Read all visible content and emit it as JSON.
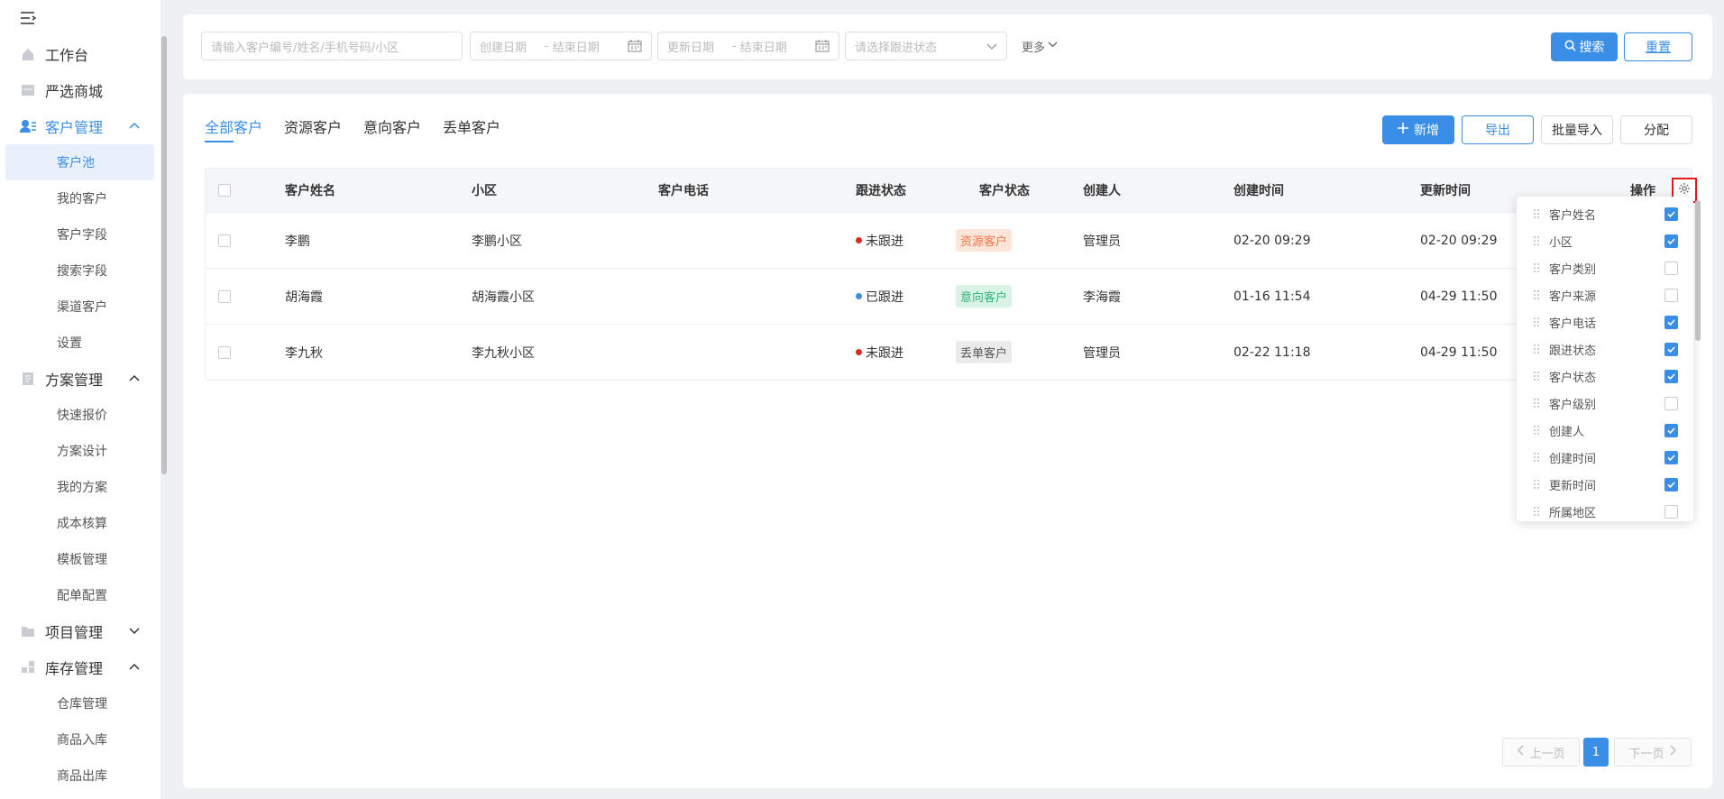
{
  "colors": {
    "accent": "#3a8ee6",
    "untracked_dot": "#e02a1a",
    "tracked_dot": "#3a8ee6"
  },
  "sidebar": {
    "toggle_icon": "menu-collapse-icon",
    "groups": [
      {
        "label": "工作台",
        "icon": "home-icon"
      },
      {
        "label": "严选商城",
        "icon": "shop-icon"
      },
      {
        "label": "客户管理",
        "icon": "customer-icon",
        "items": [
          "客户池",
          "我的客户",
          "客户字段",
          "搜索字段",
          "渠道客户",
          "设置"
        ]
      },
      {
        "label": "方案管理",
        "icon": "document-icon",
        "items": [
          "快速报价",
          "方案设计",
          "我的方案",
          "成本核算",
          "模板管理",
          "配单配置"
        ]
      },
      {
        "label": "项目管理",
        "icon": "folder-icon"
      },
      {
        "label": "库存管理",
        "icon": "inventory-icon",
        "items": [
          "仓库管理",
          "商品入库",
          "商品出库"
        ]
      }
    ]
  },
  "filters": {
    "keyword_placeholder": "请输入客户编号/姓名/手机号码/小区",
    "create_start_placeholder": "创建日期",
    "create_end_placeholder": "结束日期",
    "update_start_placeholder": "更新日期",
    "update_end_placeholder": "结束日期",
    "range_separator": "-",
    "status_placeholder": "请选择跟进状态",
    "more_label": "更多",
    "search_label": "搜索",
    "reset_label": "重置"
  },
  "tabs": [
    "全部客户",
    "资源客户",
    "意向客户",
    "丢单客户"
  ],
  "toolbar": {
    "add_label": "新增",
    "export_label": "导出",
    "import_label": "批量导入",
    "assign_label": "分配"
  },
  "table": {
    "columns": [
      "客户姓名",
      "小区",
      "客户电话",
      "跟进状态",
      "客户状态",
      "创建人",
      "创建时间",
      "更新时间",
      "操作"
    ],
    "rows": [
      {
        "name": "李鹏",
        "community": "李鹏小区",
        "phone": "",
        "follow": "未跟进",
        "status": "资源客户",
        "creator": "管理员",
        "created": "02-20 09:29",
        "updated": "02-20 09:29"
      },
      {
        "name": "胡海霞",
        "community": "胡海霞小区",
        "phone": "",
        "follow": "已跟进",
        "status": "意向客户",
        "creator": "李海霞",
        "created": "01-16 11:54",
        "updated": "04-29 11:50"
      },
      {
        "name": "李九秋",
        "community": "李九秋小区",
        "phone": "",
        "follow": "未跟进",
        "status": "丢单客户",
        "creator": "管理员",
        "created": "02-22 11:18",
        "updated": "04-29 11:50"
      }
    ]
  },
  "column_settings": [
    {
      "label": "客户姓名",
      "checked": true
    },
    {
      "label": "小区",
      "checked": true
    },
    {
      "label": "客户类别",
      "checked": false
    },
    {
      "label": "客户来源",
      "checked": false
    },
    {
      "label": "客户电话",
      "checked": true
    },
    {
      "label": "跟进状态",
      "checked": true
    },
    {
      "label": "客户状态",
      "checked": true
    },
    {
      "label": "客户级别",
      "checked": false
    },
    {
      "label": "创建人",
      "checked": true
    },
    {
      "label": "创建时间",
      "checked": true
    },
    {
      "label": "更新时间",
      "checked": true
    },
    {
      "label": "所属地区",
      "checked": false
    }
  ],
  "pagination": {
    "prev_label": "上一页",
    "current": "1",
    "next_label": "下一页"
  }
}
